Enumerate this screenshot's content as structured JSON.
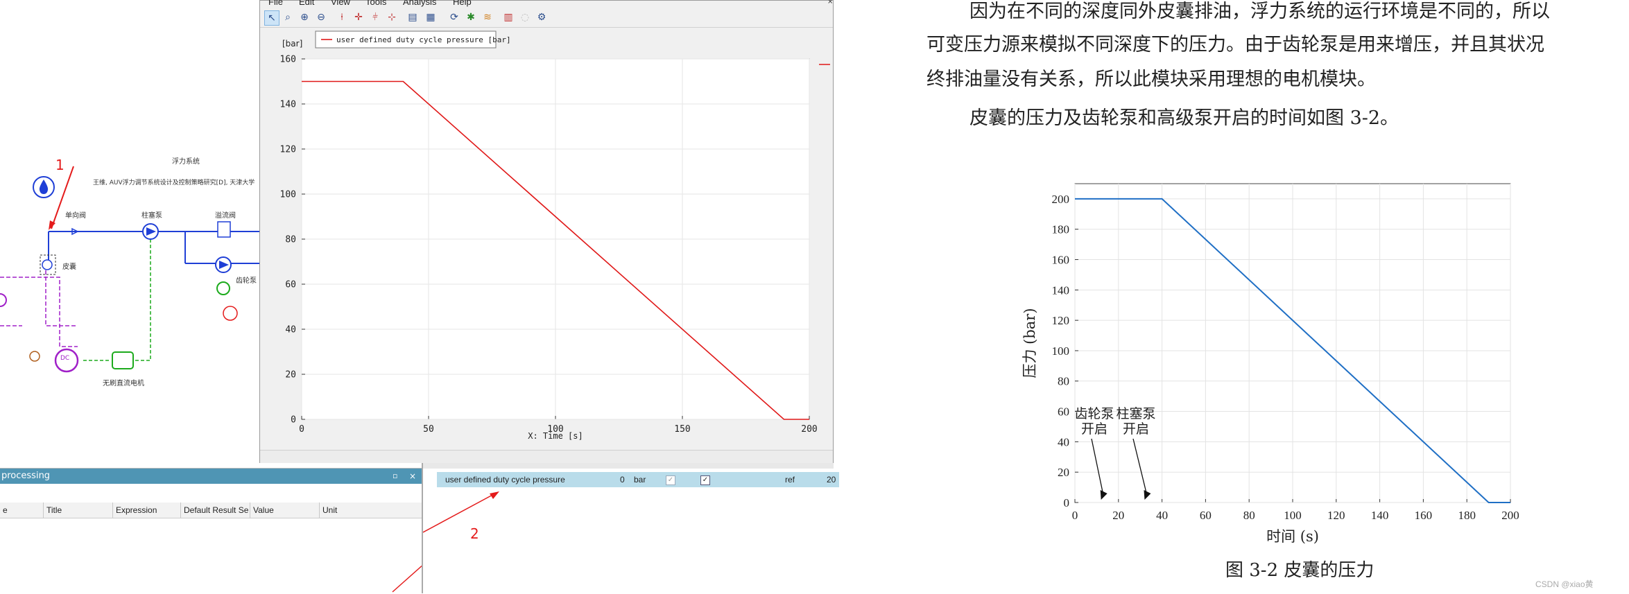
{
  "schematic": {
    "title": "浮力系统",
    "subtitle": "王维, AUV浮力调节系统设计及控制策略研究[D], 天津大学",
    "labels": {
      "check_valve": "单向阀",
      "plunger_pump": "柱塞泵",
      "relief_valve": "溢流阀",
      "bladder": "皮囊",
      "gear_pump": "齿轮泵",
      "brushless_motor": "无刷直流电机",
      "dc_motor": "DC"
    },
    "annotation_1": "1",
    "annotation_2": "2",
    "colors": {
      "hydraulic": "#1f3fd6",
      "signal": "#a020c8",
      "mechanical": "#1caa1c",
      "arrow": "#e41b1b"
    }
  },
  "plot_window": {
    "menu": [
      "File",
      "Edit",
      "View",
      "Tools",
      "Analysis",
      "Help"
    ],
    "toolbar_icons": [
      "pointer-icon",
      "zoom-area-icon",
      "zoom-in-icon",
      "zoom-out-icon",
      "cursor-v-icon",
      "cursor-cross-icon",
      "cursor-multi-icon",
      "cursor-slope-icon",
      "table-icon",
      "grid-icon",
      "refresh-icon",
      "pin-icon",
      "style-icon",
      "bar-chart-icon",
      "disabled-icon",
      "settings-icon"
    ],
    "legend": "user defined duty cycle pressure [bar]"
  },
  "chart_data": [
    {
      "type": "line",
      "title": "",
      "ylabel": "[bar]",
      "xlabel": "X: Time [s]",
      "xlim": [
        0,
        200
      ],
      "ylim": [
        0,
        160
      ],
      "xticks": [
        0,
        50,
        100,
        150,
        200
      ],
      "yticks": [
        0,
        20,
        40,
        60,
        80,
        100,
        120,
        140,
        160
      ],
      "grid": true,
      "legend_position": "top-left",
      "series": [
        {
          "name": "user defined duty cycle pressure [bar]",
          "color": "#e01818",
          "x": [
            0,
            40,
            190,
            200
          ],
          "y": [
            150,
            150,
            0,
            0
          ]
        }
      ]
    },
    {
      "type": "line",
      "title": "",
      "ylabel": "压力 (bar)",
      "xlabel": "时间 (s)",
      "xlim": [
        0,
        200
      ],
      "ylim": [
        0,
        210
      ],
      "xticks": [
        0,
        20,
        40,
        60,
        80,
        100,
        120,
        140,
        160,
        180,
        200
      ],
      "yticks": [
        0,
        20,
        40,
        60,
        80,
        100,
        120,
        140,
        160,
        180,
        200
      ],
      "grid": true,
      "series": [
        {
          "color": "#1f6fc5",
          "x": [
            0,
            40,
            190,
            200
          ],
          "y": [
            200,
            200,
            0,
            0
          ]
        }
      ],
      "annotations": [
        {
          "text1": "齿轮泵",
          "text2": "开启",
          "x": 12,
          "y": 0
        },
        {
          "text1": "柱塞泵",
          "text2": "开启",
          "x": 32,
          "y": 0
        }
      ]
    }
  ],
  "postprocessing": {
    "title": "processing",
    "columns": [
      "e",
      "Title",
      "Expression",
      "Default Result Se",
      "Value",
      "Unit"
    ]
  },
  "variable_row": {
    "name": "user defined duty cycle pressure",
    "value": "0",
    "unit": "bar",
    "ref": "ref",
    "extra": "20"
  },
  "document": {
    "para1_line1": "因为在不同的深度同外皮囊排油，浮力系统的运行环境是不同的，所以",
    "para1_line2": "可变压力源来模拟不同深度下的压力。由于齿轮泵是用来增压，并且其状况",
    "para1_line3": "终排油量没有关系，所以此模块采用理想的电机模块。",
    "para2": "皮囊的压力及齿轮泵和高级泵开启的时间如图 3-2。",
    "figure_caption": "图 3-2  皮囊的压力",
    "watermark": "CSDN @xiao黄"
  }
}
